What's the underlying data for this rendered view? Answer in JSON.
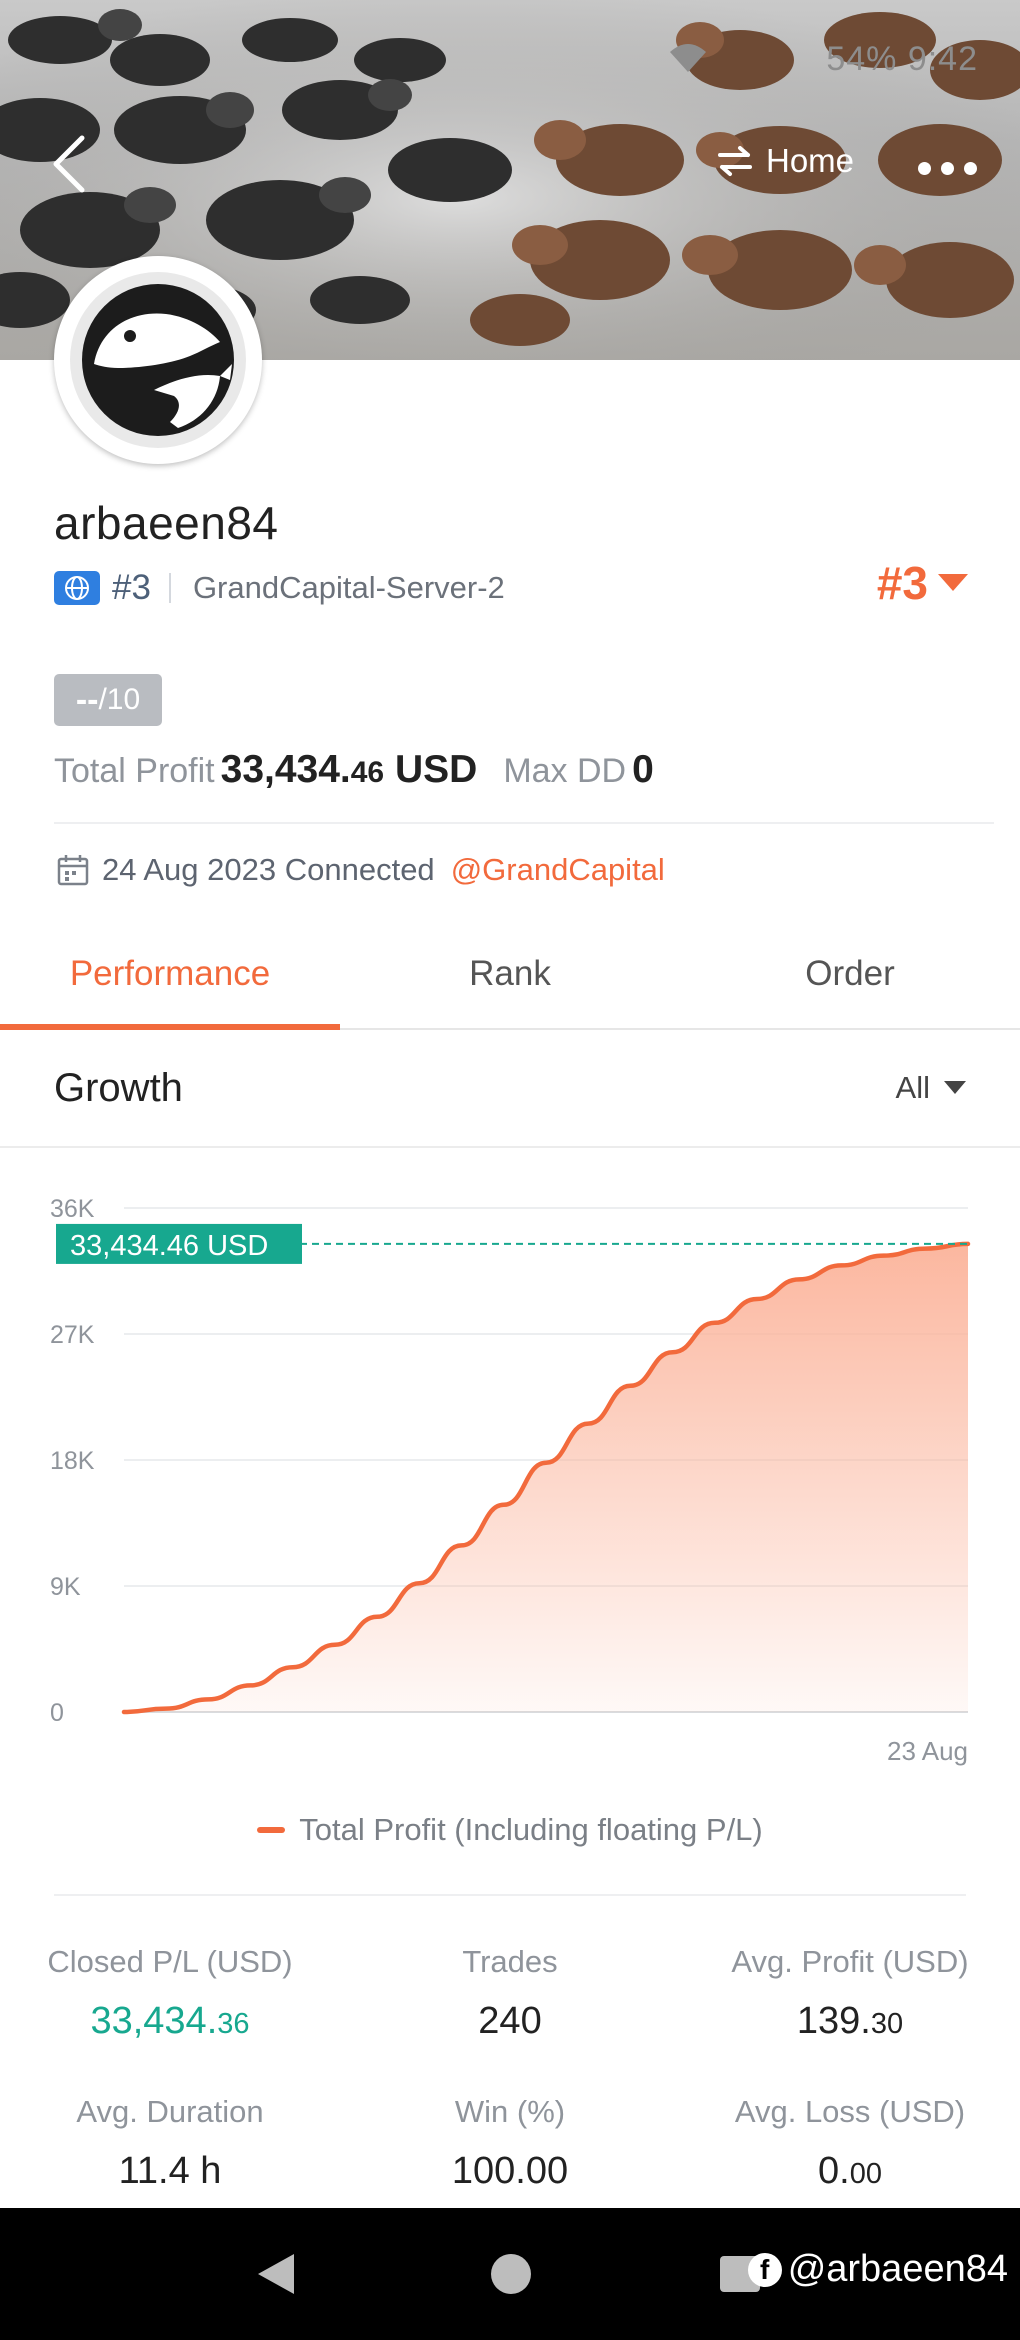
{
  "status_bar": {
    "battery_time": "54% 9:42"
  },
  "header": {
    "home_label": "Home"
  },
  "profile": {
    "username": "arbaeen84",
    "rank_small": "#3",
    "server": "GrandCapital-Server-2",
    "rank_big": "#3",
    "score_dashes": "--",
    "score_suffix": "/10",
    "total_profit_label": "Total Profit",
    "total_profit_int": "33,434.",
    "total_profit_dec": "46",
    "total_profit_unit": " USD",
    "max_dd_label": "Max DD",
    "max_dd_value": "0",
    "connected_text": "24 Aug 2023 Connected",
    "broker": "@GrandCapital"
  },
  "tabs": [
    {
      "label": "Performance",
      "active": true
    },
    {
      "label": "Rank",
      "active": false
    },
    {
      "label": "Order",
      "active": false
    }
  ],
  "growth": {
    "title": "Growth",
    "filter": "All"
  },
  "chart_data": {
    "type": "area",
    "title": "",
    "x_labels": [
      "23 Aug"
    ],
    "y_ticks": [
      "36K",
      "27K",
      "18K",
      "9K",
      "0"
    ],
    "ylim": [
      0,
      36000
    ],
    "current_value_label": "33,434.46 USD",
    "current_value": 33434.46,
    "series": [
      {
        "name": "Total Profit (Including floating P/L)",
        "x": [
          0,
          0.05,
          0.1,
          0.15,
          0.2,
          0.25,
          0.3,
          0.35,
          0.4,
          0.45,
          0.5,
          0.55,
          0.6,
          0.65,
          0.7,
          0.75,
          0.8,
          0.85,
          0.9,
          0.95,
          1.0
        ],
        "values": [
          0,
          240,
          900,
          1900,
          3200,
          4800,
          6800,
          9200,
          11900,
          14800,
          17800,
          20600,
          23300,
          25700,
          27800,
          29500,
          30900,
          31900,
          32600,
          33100,
          33434.46
        ]
      }
    ],
    "colors": {
      "line": "#f26a3c",
      "fill": "#fbb39a",
      "marker": "#17a88f"
    },
    "grid": true
  },
  "legend_label": "Total Profit (Including floating P/L)",
  "stats": [
    {
      "label": "Closed P/L (USD)",
      "int": "33,434.",
      "dec": "36",
      "positive": true
    },
    {
      "label": "Trades",
      "int": "240",
      "dec": "",
      "positive": false
    },
    {
      "label": "Avg. Profit (USD)",
      "int": "139.",
      "dec": "30",
      "positive": false
    },
    {
      "label": "Avg. Duration",
      "int": "11.4 h",
      "dec": "",
      "positive": false
    },
    {
      "label": "Win (%)",
      "int": "100.00",
      "dec": "",
      "positive": false
    },
    {
      "label": "Avg. Loss (USD)",
      "int": "0.",
      "dec": "00",
      "positive": false
    }
  ],
  "watermark": "@arbaeen84"
}
